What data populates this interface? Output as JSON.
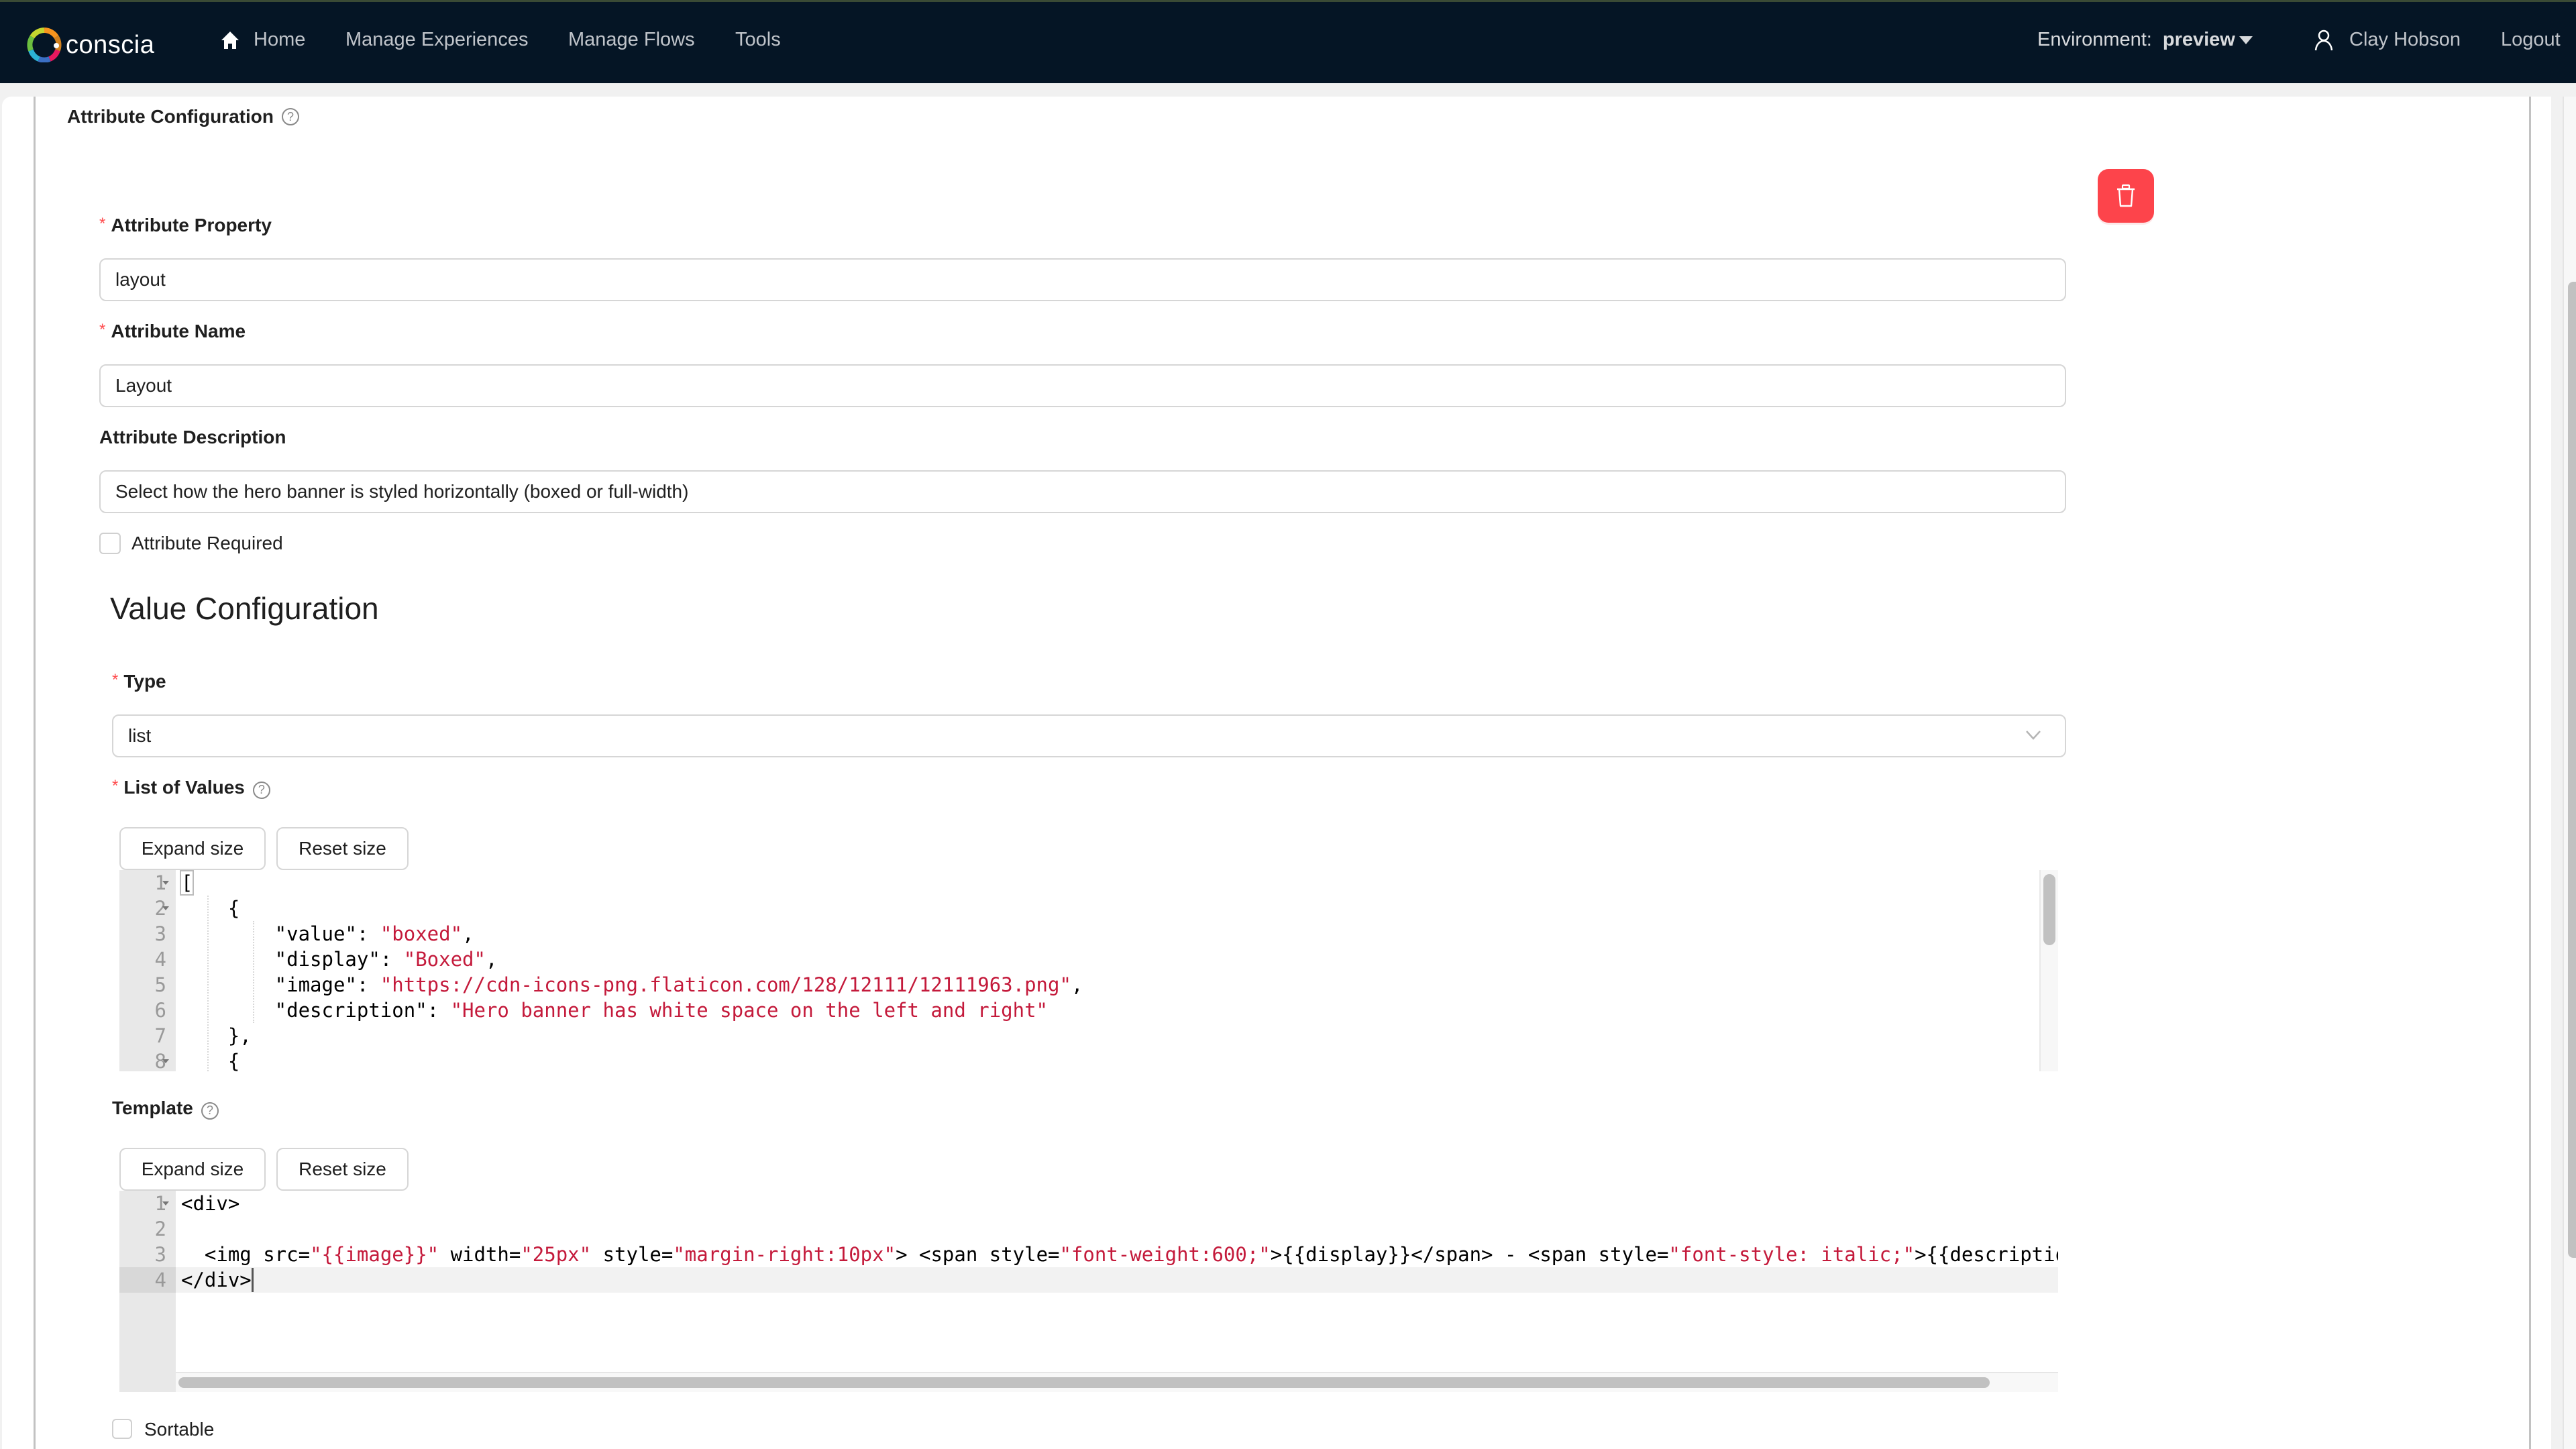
{
  "nav": {
    "brand": "conscia",
    "items": [
      {
        "label": "Home",
        "icon": "home-icon"
      },
      {
        "label": "Manage Experiences"
      },
      {
        "label": "Manage Flows"
      },
      {
        "label": "Tools"
      }
    ],
    "environment_label": "Environment:",
    "environment_value": "preview",
    "user_name": "Clay Hobson",
    "logout_label": "Logout"
  },
  "attribute_config": {
    "title": "Attribute Configuration",
    "help": "?",
    "delete_icon": "trash-icon",
    "property_label": "Attribute Property",
    "property_value": "layout",
    "name_label": "Attribute Name",
    "name_value": "Layout",
    "description_label": "Attribute Description",
    "description_value": "Select how the hero banner is styled horizontally (boxed or full-width)",
    "required_label": "Attribute Required",
    "required_checked": false
  },
  "value_config": {
    "title": "Value Configuration",
    "type_label": "Type",
    "type_value": "list",
    "list_label": "List of Values",
    "expand_label": "Expand size",
    "reset_label": "Reset size",
    "list_editor": {
      "line_numbers": [
        "1",
        "2",
        "3",
        "4",
        "5",
        "6",
        "7",
        "8"
      ],
      "lines": [
        [
          {
            "t": "["
          }
        ],
        [
          {
            "t": "    {"
          }
        ],
        [
          {
            "t": "        \"value\": "
          },
          {
            "t": "\"boxed\"",
            "s": 1
          },
          {
            "t": ","
          }
        ],
        [
          {
            "t": "        \"display\": "
          },
          {
            "t": "\"Boxed\"",
            "s": 1
          },
          {
            "t": ","
          }
        ],
        [
          {
            "t": "        \"image\": "
          },
          {
            "t": "\"https://cdn-icons-png.flaticon.com/128/12111/12111963.png\"",
            "s": 1
          },
          {
            "t": ","
          }
        ],
        [
          {
            "t": "        \"description\": "
          },
          {
            "t": "\"Hero banner has white space on the left and right\"",
            "s": 1
          }
        ],
        [
          {
            "t": "    },"
          }
        ],
        [
          {
            "t": "    {"
          }
        ]
      ]
    },
    "template_label": "Template",
    "template_editor": {
      "line_numbers": [
        "1",
        "2",
        "3",
        "4"
      ],
      "lines": [
        [
          {
            "t": "<div>"
          }
        ],
        [
          {
            "t": ""
          }
        ],
        [
          {
            "t": "  <img src="
          },
          {
            "t": "\"{{image}}\"",
            "s": 1
          },
          {
            "t": " width="
          },
          {
            "t": "\"25px\"",
            "s": 1
          },
          {
            "t": " style="
          },
          {
            "t": "\"margin-right:10px\"",
            "s": 1
          },
          {
            "t": "> <span style="
          },
          {
            "t": "\"font-weight:600;\"",
            "s": 1
          },
          {
            "t": ">{{display}}</span> - <span style="
          },
          {
            "t": "\"font-style: italic;\"",
            "s": 1
          },
          {
            "t": ">{{description}} </span>"
          }
        ],
        [
          {
            "t": "</div>"
          }
        ]
      ]
    },
    "sortable_label": "Sortable",
    "sortable_checked": false
  },
  "colors": {
    "navbar_bg": "#051525",
    "danger": "#fd444b",
    "required_asterisk": "#ff4d4f",
    "code_string": "#c41a3b"
  }
}
